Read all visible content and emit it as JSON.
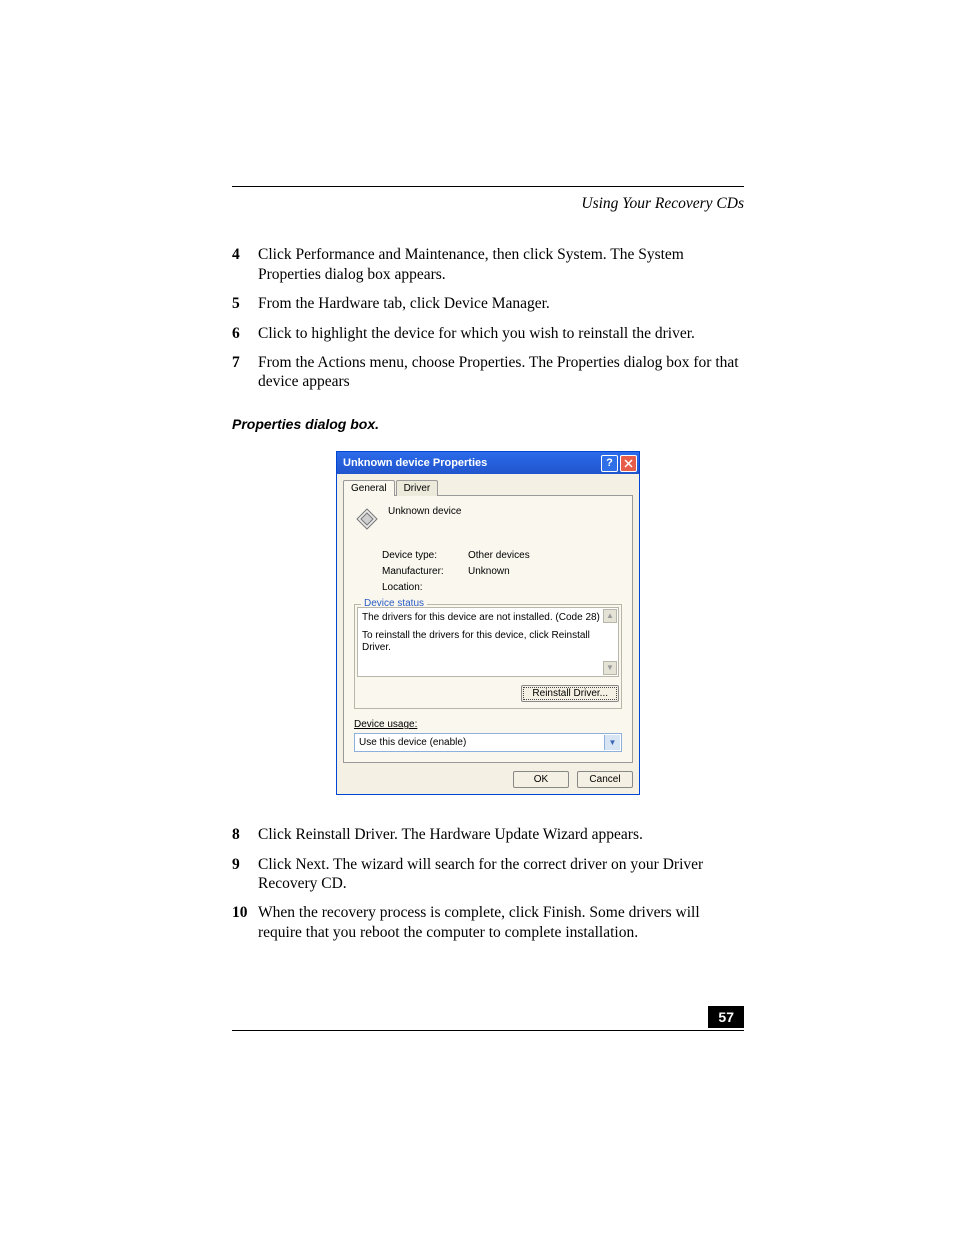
{
  "header": {
    "running_head": "Using Your Recovery CDs"
  },
  "steps_a": [
    {
      "n": "4",
      "t": "Click Performance and Maintenance, then click System. The System Properties dialog box appears."
    },
    {
      "n": "5",
      "t": "From the Hardware tab, click Device Manager."
    },
    {
      "n": "6",
      "t": "Click to highlight the device for which you wish to reinstall the driver."
    },
    {
      "n": "7",
      "t": "From the Actions menu, choose Properties. The Properties dialog box for that device appears"
    }
  ],
  "caption": "Properties dialog box.",
  "dialog": {
    "title": "Unknown device Properties",
    "tabs": {
      "general": "General",
      "driver": "Driver"
    },
    "device_name": "Unknown device",
    "info": {
      "type_k": "Device type:",
      "type_v": "Other devices",
      "manu_k": "Manufacturer:",
      "manu_v": "Unknown",
      "loc_k": "Location:",
      "loc_v": ""
    },
    "status_label": "Device status",
    "status_line1": "The drivers for this device are not installed. (Code 28)",
    "status_line2": "To reinstall the drivers for this device, click Reinstall Driver.",
    "reinstall_btn": "Reinstall Driver...",
    "usage_label_pre": "D",
    "usage_label_rest": "evice usage:",
    "usage_value": "Use this device (enable)",
    "ok": "OK",
    "cancel": "Cancel"
  },
  "steps_b": [
    {
      "n": "8",
      "t": "Click Reinstall Driver. The Hardware Update Wizard appears."
    },
    {
      "n": "9",
      "t": "Click Next. The wizard will search for the correct driver on your Driver Recovery CD."
    },
    {
      "n": "10",
      "t": "When the recovery process is complete, click Finish. Some drivers will require that you reboot the computer to complete installation."
    }
  ],
  "page_number": "57"
}
